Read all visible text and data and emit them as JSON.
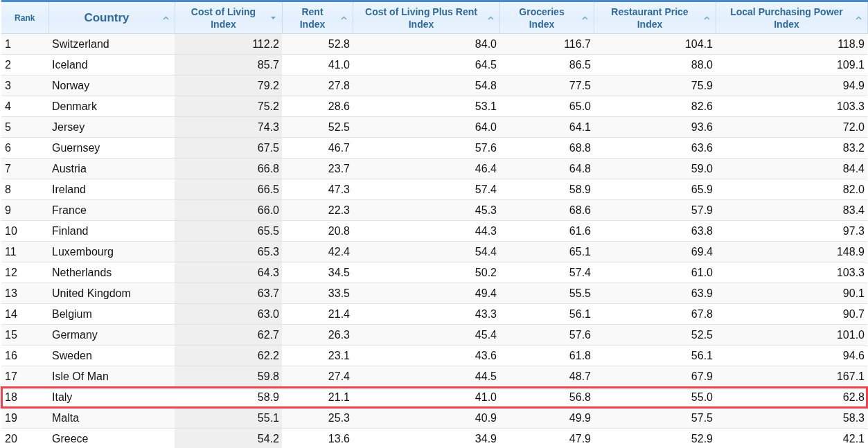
{
  "table": {
    "columns": [
      {
        "label": "Rank",
        "kind": "rank",
        "selected": false
      },
      {
        "label": "Country",
        "kind": "name",
        "descending": false,
        "selected": false
      },
      {
        "label": "Cost of Living Index",
        "kind": "index",
        "descending": true,
        "selected": true
      },
      {
        "label": "Rent Index",
        "kind": "index",
        "descending": false,
        "selected": false
      },
      {
        "label": "Cost of Living Plus Rent Index",
        "kind": "index",
        "descending": false,
        "selected": false
      },
      {
        "label": "Groceries Index",
        "kind": "index",
        "descending": false,
        "selected": false
      },
      {
        "label": "Restaurant Price Index",
        "kind": "index",
        "descending": false,
        "selected": false
      },
      {
        "label": "Local Purchasing Power Index",
        "kind": "index",
        "descending": false,
        "selected": false
      }
    ],
    "rows": [
      {
        "cells": [
          "1",
          "Switzerland",
          "112.2",
          "52.8",
          "84.0",
          "116.7",
          "104.1",
          "118.9"
        ],
        "highlighted": false
      },
      {
        "cells": [
          "2",
          "Iceland",
          "85.7",
          "41.0",
          "64.5",
          "86.5",
          "88.0",
          "109.1"
        ],
        "highlighted": false
      },
      {
        "cells": [
          "3",
          "Norway",
          "79.2",
          "27.8",
          "54.8",
          "77.5",
          "75.9",
          "94.9"
        ],
        "highlighted": false
      },
      {
        "cells": [
          "4",
          "Denmark",
          "75.2",
          "28.6",
          "53.1",
          "65.0",
          "82.6",
          "103.3"
        ],
        "highlighted": false
      },
      {
        "cells": [
          "5",
          "Jersey",
          "74.3",
          "52.5",
          "64.0",
          "64.1",
          "93.6",
          "72.0"
        ],
        "highlighted": false
      },
      {
        "cells": [
          "6",
          "Guernsey",
          "67.5",
          "46.7",
          "57.6",
          "68.8",
          "63.6",
          "83.2"
        ],
        "highlighted": false
      },
      {
        "cells": [
          "7",
          "Austria",
          "66.8",
          "23.7",
          "46.4",
          "64.8",
          "59.0",
          "84.4"
        ],
        "highlighted": false
      },
      {
        "cells": [
          "8",
          "Ireland",
          "66.5",
          "47.3",
          "57.4",
          "58.9",
          "65.9",
          "82.0"
        ],
        "highlighted": false
      },
      {
        "cells": [
          "9",
          "France",
          "66.0",
          "22.3",
          "45.3",
          "68.6",
          "57.9",
          "83.4"
        ],
        "highlighted": false
      },
      {
        "cells": [
          "10",
          "Finland",
          "65.5",
          "20.8",
          "44.3",
          "61.6",
          "63.8",
          "97.3"
        ],
        "highlighted": false
      },
      {
        "cells": [
          "11",
          "Luxembourg",
          "65.3",
          "42.4",
          "54.4",
          "65.1",
          "69.4",
          "148.9"
        ],
        "highlighted": false
      },
      {
        "cells": [
          "12",
          "Netherlands",
          "64.3",
          "34.5",
          "50.2",
          "57.4",
          "61.0",
          "103.3"
        ],
        "highlighted": false
      },
      {
        "cells": [
          "13",
          "United Kingdom",
          "63.7",
          "33.5",
          "49.4",
          "55.5",
          "63.9",
          "90.1"
        ],
        "highlighted": false
      },
      {
        "cells": [
          "14",
          "Belgium",
          "63.0",
          "21.4",
          "43.3",
          "56.1",
          "67.8",
          "90.7"
        ],
        "highlighted": false
      },
      {
        "cells": [
          "15",
          "Germany",
          "62.7",
          "26.3",
          "45.4",
          "57.6",
          "52.5",
          "101.0"
        ],
        "highlighted": false
      },
      {
        "cells": [
          "16",
          "Sweden",
          "62.2",
          "23.1",
          "43.6",
          "61.8",
          "56.1",
          "94.6"
        ],
        "highlighted": false
      },
      {
        "cells": [
          "17",
          "Isle Of Man",
          "59.8",
          "27.4",
          "44.5",
          "48.7",
          "67.9",
          "167.1"
        ],
        "highlighted": false
      },
      {
        "cells": [
          "18",
          "Italy",
          "58.9",
          "21.1",
          "41.0",
          "56.8",
          "55.0",
          "62.8"
        ],
        "highlighted": true
      },
      {
        "cells": [
          "19",
          "Malta",
          "55.1",
          "25.3",
          "40.9",
          "49.9",
          "57.5",
          "58.3"
        ],
        "highlighted": false
      },
      {
        "cells": [
          "20",
          "Greece",
          "54.2",
          "13.6",
          "34.9",
          "47.9",
          "52.9",
          "42.1"
        ],
        "highlighted": false
      }
    ]
  }
}
